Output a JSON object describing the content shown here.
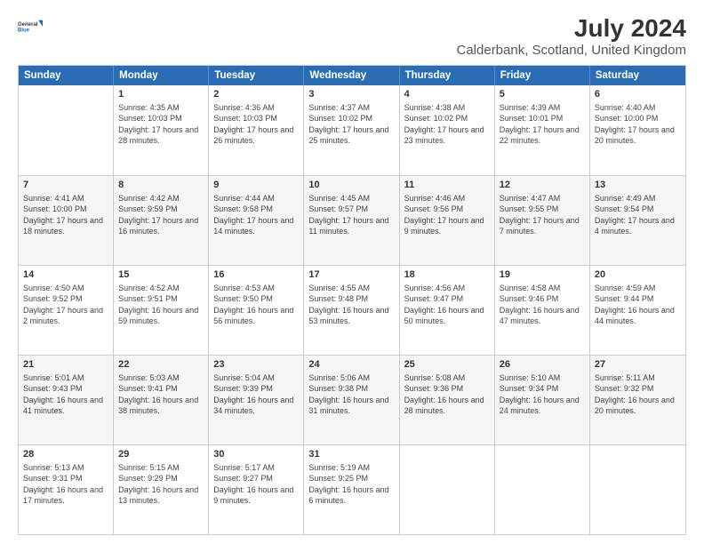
{
  "header": {
    "title": "July 2024",
    "subtitle": "Calderbank, Scotland, United Kingdom",
    "logo_general": "General",
    "logo_blue": "Blue"
  },
  "weekdays": [
    "Sunday",
    "Monday",
    "Tuesday",
    "Wednesday",
    "Thursday",
    "Friday",
    "Saturday"
  ],
  "rows": [
    [
      {
        "day": "",
        "sunrise": "",
        "sunset": "",
        "daylight": ""
      },
      {
        "day": "1",
        "sunrise": "Sunrise: 4:35 AM",
        "sunset": "Sunset: 10:03 PM",
        "daylight": "Daylight: 17 hours and 28 minutes."
      },
      {
        "day": "2",
        "sunrise": "Sunrise: 4:36 AM",
        "sunset": "Sunset: 10:03 PM",
        "daylight": "Daylight: 17 hours and 26 minutes."
      },
      {
        "day": "3",
        "sunrise": "Sunrise: 4:37 AM",
        "sunset": "Sunset: 10:02 PM",
        "daylight": "Daylight: 17 hours and 25 minutes."
      },
      {
        "day": "4",
        "sunrise": "Sunrise: 4:38 AM",
        "sunset": "Sunset: 10:02 PM",
        "daylight": "Daylight: 17 hours and 23 minutes."
      },
      {
        "day": "5",
        "sunrise": "Sunrise: 4:39 AM",
        "sunset": "Sunset: 10:01 PM",
        "daylight": "Daylight: 17 hours and 22 minutes."
      },
      {
        "day": "6",
        "sunrise": "Sunrise: 4:40 AM",
        "sunset": "Sunset: 10:00 PM",
        "daylight": "Daylight: 17 hours and 20 minutes."
      }
    ],
    [
      {
        "day": "7",
        "sunrise": "Sunrise: 4:41 AM",
        "sunset": "Sunset: 10:00 PM",
        "daylight": "Daylight: 17 hours and 18 minutes."
      },
      {
        "day": "8",
        "sunrise": "Sunrise: 4:42 AM",
        "sunset": "Sunset: 9:59 PM",
        "daylight": "Daylight: 17 hours and 16 minutes."
      },
      {
        "day": "9",
        "sunrise": "Sunrise: 4:44 AM",
        "sunset": "Sunset: 9:58 PM",
        "daylight": "Daylight: 17 hours and 14 minutes."
      },
      {
        "day": "10",
        "sunrise": "Sunrise: 4:45 AM",
        "sunset": "Sunset: 9:57 PM",
        "daylight": "Daylight: 17 hours and 11 minutes."
      },
      {
        "day": "11",
        "sunrise": "Sunrise: 4:46 AM",
        "sunset": "Sunset: 9:56 PM",
        "daylight": "Daylight: 17 hours and 9 minutes."
      },
      {
        "day": "12",
        "sunrise": "Sunrise: 4:47 AM",
        "sunset": "Sunset: 9:55 PM",
        "daylight": "Daylight: 17 hours and 7 minutes."
      },
      {
        "day": "13",
        "sunrise": "Sunrise: 4:49 AM",
        "sunset": "Sunset: 9:54 PM",
        "daylight": "Daylight: 17 hours and 4 minutes."
      }
    ],
    [
      {
        "day": "14",
        "sunrise": "Sunrise: 4:50 AM",
        "sunset": "Sunset: 9:52 PM",
        "daylight": "Daylight: 17 hours and 2 minutes."
      },
      {
        "day": "15",
        "sunrise": "Sunrise: 4:52 AM",
        "sunset": "Sunset: 9:51 PM",
        "daylight": "Daylight: 16 hours and 59 minutes."
      },
      {
        "day": "16",
        "sunrise": "Sunrise: 4:53 AM",
        "sunset": "Sunset: 9:50 PM",
        "daylight": "Daylight: 16 hours and 56 minutes."
      },
      {
        "day": "17",
        "sunrise": "Sunrise: 4:55 AM",
        "sunset": "Sunset: 9:48 PM",
        "daylight": "Daylight: 16 hours and 53 minutes."
      },
      {
        "day": "18",
        "sunrise": "Sunrise: 4:56 AM",
        "sunset": "Sunset: 9:47 PM",
        "daylight": "Daylight: 16 hours and 50 minutes."
      },
      {
        "day": "19",
        "sunrise": "Sunrise: 4:58 AM",
        "sunset": "Sunset: 9:46 PM",
        "daylight": "Daylight: 16 hours and 47 minutes."
      },
      {
        "day": "20",
        "sunrise": "Sunrise: 4:59 AM",
        "sunset": "Sunset: 9:44 PM",
        "daylight": "Daylight: 16 hours and 44 minutes."
      }
    ],
    [
      {
        "day": "21",
        "sunrise": "Sunrise: 5:01 AM",
        "sunset": "Sunset: 9:43 PM",
        "daylight": "Daylight: 16 hours and 41 minutes."
      },
      {
        "day": "22",
        "sunrise": "Sunrise: 5:03 AM",
        "sunset": "Sunset: 9:41 PM",
        "daylight": "Daylight: 16 hours and 38 minutes."
      },
      {
        "day": "23",
        "sunrise": "Sunrise: 5:04 AM",
        "sunset": "Sunset: 9:39 PM",
        "daylight": "Daylight: 16 hours and 34 minutes."
      },
      {
        "day": "24",
        "sunrise": "Sunrise: 5:06 AM",
        "sunset": "Sunset: 9:38 PM",
        "daylight": "Daylight: 16 hours and 31 minutes."
      },
      {
        "day": "25",
        "sunrise": "Sunrise: 5:08 AM",
        "sunset": "Sunset: 9:36 PM",
        "daylight": "Daylight: 16 hours and 28 minutes."
      },
      {
        "day": "26",
        "sunrise": "Sunrise: 5:10 AM",
        "sunset": "Sunset: 9:34 PM",
        "daylight": "Daylight: 16 hours and 24 minutes."
      },
      {
        "day": "27",
        "sunrise": "Sunrise: 5:11 AM",
        "sunset": "Sunset: 9:32 PM",
        "daylight": "Daylight: 16 hours and 20 minutes."
      }
    ],
    [
      {
        "day": "28",
        "sunrise": "Sunrise: 5:13 AM",
        "sunset": "Sunset: 9:31 PM",
        "daylight": "Daylight: 16 hours and 17 minutes."
      },
      {
        "day": "29",
        "sunrise": "Sunrise: 5:15 AM",
        "sunset": "Sunset: 9:29 PM",
        "daylight": "Daylight: 16 hours and 13 minutes."
      },
      {
        "day": "30",
        "sunrise": "Sunrise: 5:17 AM",
        "sunset": "Sunset: 9:27 PM",
        "daylight": "Daylight: 16 hours and 9 minutes."
      },
      {
        "day": "31",
        "sunrise": "Sunrise: 5:19 AM",
        "sunset": "Sunset: 9:25 PM",
        "daylight": "Daylight: 16 hours and 6 minutes."
      },
      {
        "day": "",
        "sunrise": "",
        "sunset": "",
        "daylight": ""
      },
      {
        "day": "",
        "sunrise": "",
        "sunset": "",
        "daylight": ""
      },
      {
        "day": "",
        "sunrise": "",
        "sunset": "",
        "daylight": ""
      }
    ]
  ]
}
